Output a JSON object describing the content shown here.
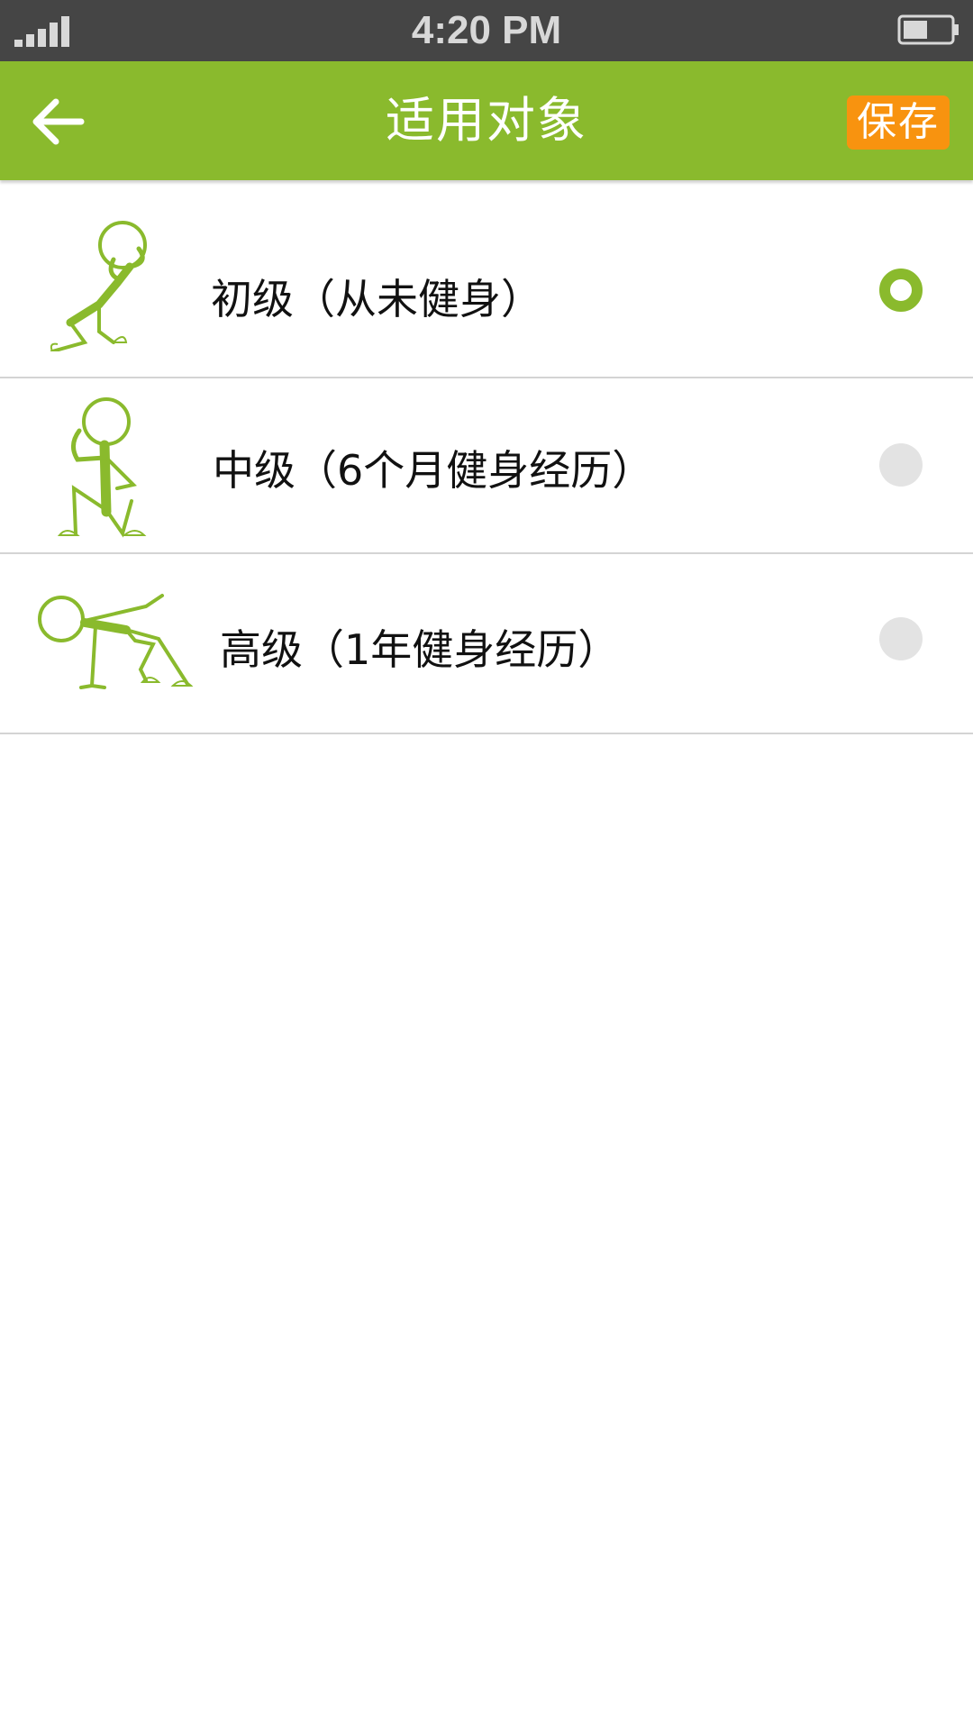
{
  "status_bar": {
    "time": "4:20 PM",
    "signal_icon": "signal-bars-icon",
    "battery_icon": "battery-icon"
  },
  "header": {
    "back_icon": "back-arrow-icon",
    "title": "适用对象",
    "save_label": "保存"
  },
  "levels": [
    {
      "label": "初级（从未健身）",
      "selected": true,
      "icon": "stick-figure-beginner-icon"
    },
    {
      "label": "中级（6个月健身经历）",
      "selected": false,
      "icon": "stick-figure-intermediate-icon"
    },
    {
      "label": "高级（1年健身经历）",
      "selected": false,
      "icon": "stick-figure-advanced-icon"
    }
  ],
  "colors": {
    "status_bar_bg": "#454545",
    "header_bg": "#8aba2d",
    "accent_green": "#8aba2d",
    "save_button_bg": "#f8930f",
    "radio_off": "#e3e3e3",
    "divider": "#d4d4d4"
  }
}
